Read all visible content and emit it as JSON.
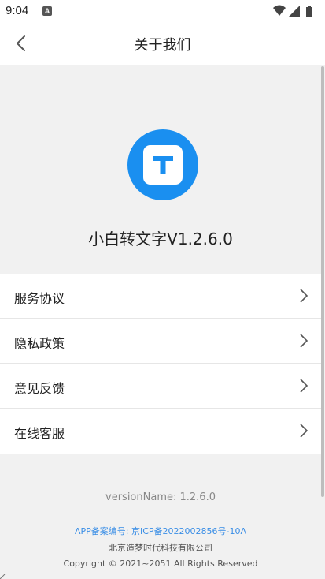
{
  "status_bar": {
    "time": "9:04",
    "app_icon_letter": "A",
    "icons": [
      "wifi-icon",
      "signal-icon",
      "battery-icon"
    ]
  },
  "header": {
    "title": "关于我们",
    "back_icon": "chevron-left-icon"
  },
  "app": {
    "logo_letter": "T",
    "name": "小白转文字V1.2.6.0",
    "logo_color": "#1a8ff0"
  },
  "menu": {
    "items": [
      {
        "label": "服务协议"
      },
      {
        "label": "隐私政策"
      },
      {
        "label": "意见反馈"
      },
      {
        "label": "在线客服"
      }
    ],
    "arrow_icon": "chevron-right-icon"
  },
  "footer": {
    "version": "versionName: 1.2.6.0",
    "icp": "APP备案编号: 京ICP备2022002856号-10A",
    "company": "北京造梦时代科技有限公司",
    "copyright": "Copyright © 2021~2051 All Rights Reserved"
  },
  "colors": {
    "accent": "#1a8ff0",
    "link": "#3a8ee6",
    "background": "#f1f1f1"
  }
}
